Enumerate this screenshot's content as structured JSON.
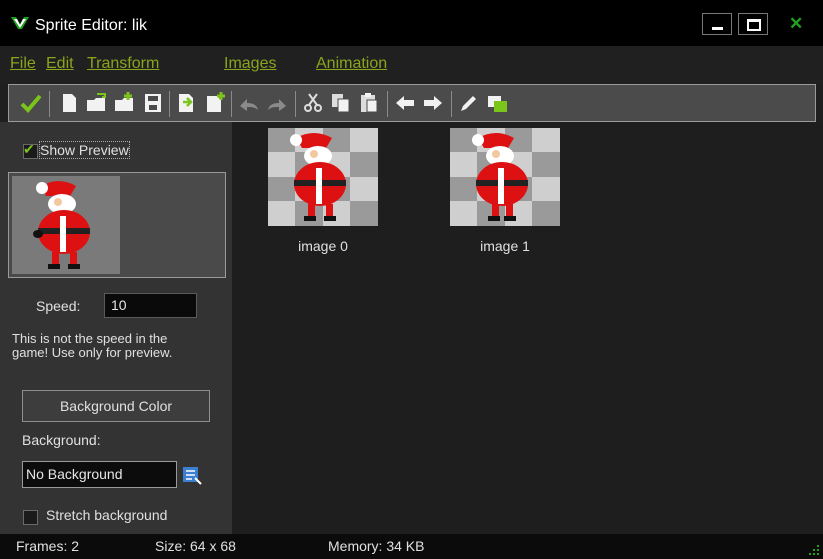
{
  "window": {
    "title": "Sprite Editor: lik"
  },
  "menu": [
    "File",
    "Edit",
    "Transform",
    "Images",
    "Animation"
  ],
  "toolbar": {
    "buttons": [
      "ok-check-icon",
      "new-icon",
      "open-icon",
      "add-from-file-icon",
      "save-icon",
      "insert-image-icon",
      "add-image-icon",
      "undo-icon",
      "redo-icon",
      "cut-icon",
      "copy-icon",
      "paste-icon",
      "move-left-icon",
      "move-right-icon",
      "edit-pencil-icon",
      "edit-frames-icon"
    ]
  },
  "sidebar": {
    "show_preview_label": "Show Preview",
    "show_preview_checked": true,
    "speed_label": "Speed:",
    "speed_value": "10",
    "speed_note": "This is not the speed in the game! Use only for preview.",
    "bg_color_button": "Background Color",
    "background_label": "Background:",
    "background_value": "No Background",
    "stretch_label": "Stretch background",
    "stretch_checked": false
  },
  "images": [
    {
      "label": "image 0"
    },
    {
      "label": "image 1"
    }
  ],
  "status": {
    "frames": "Frames: 2",
    "size": "Size: 64 x 68",
    "memory": "Memory: 34 KB"
  },
  "colors": {
    "accent_green": "#8aa41c",
    "check_green": "#7ac41c",
    "close_green": "#1ea21e"
  }
}
